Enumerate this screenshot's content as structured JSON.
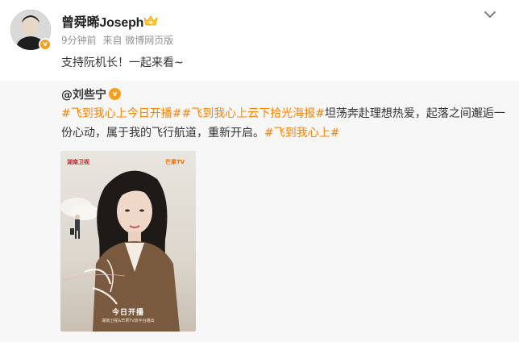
{
  "post": {
    "author": "曾舜晞Joseph",
    "time": "9分钟前",
    "source": "来自 微博网页版",
    "text": "支持阮机长！一起来看~"
  },
  "repost": {
    "author": "@刘些宁",
    "topic1": "#飞到我心上今日开播#",
    "topic2": "#飞到我心上云下拾光海报#",
    "body1": "坦荡奔赴理想热爱，起落之间邂逅一份心动，属于我的飞行航道，重新开启。",
    "topic3": "#飞到我心上#",
    "poster": {
      "logo_left": "湖南卫视",
      "logo_right": "芒果TV",
      "air_text": "今日开播",
      "channels": "湖南卫视&芒果TV双平台播出"
    }
  },
  "colors": {
    "topic": "#ff8200",
    "verified_badge": "#f79e1b"
  }
}
